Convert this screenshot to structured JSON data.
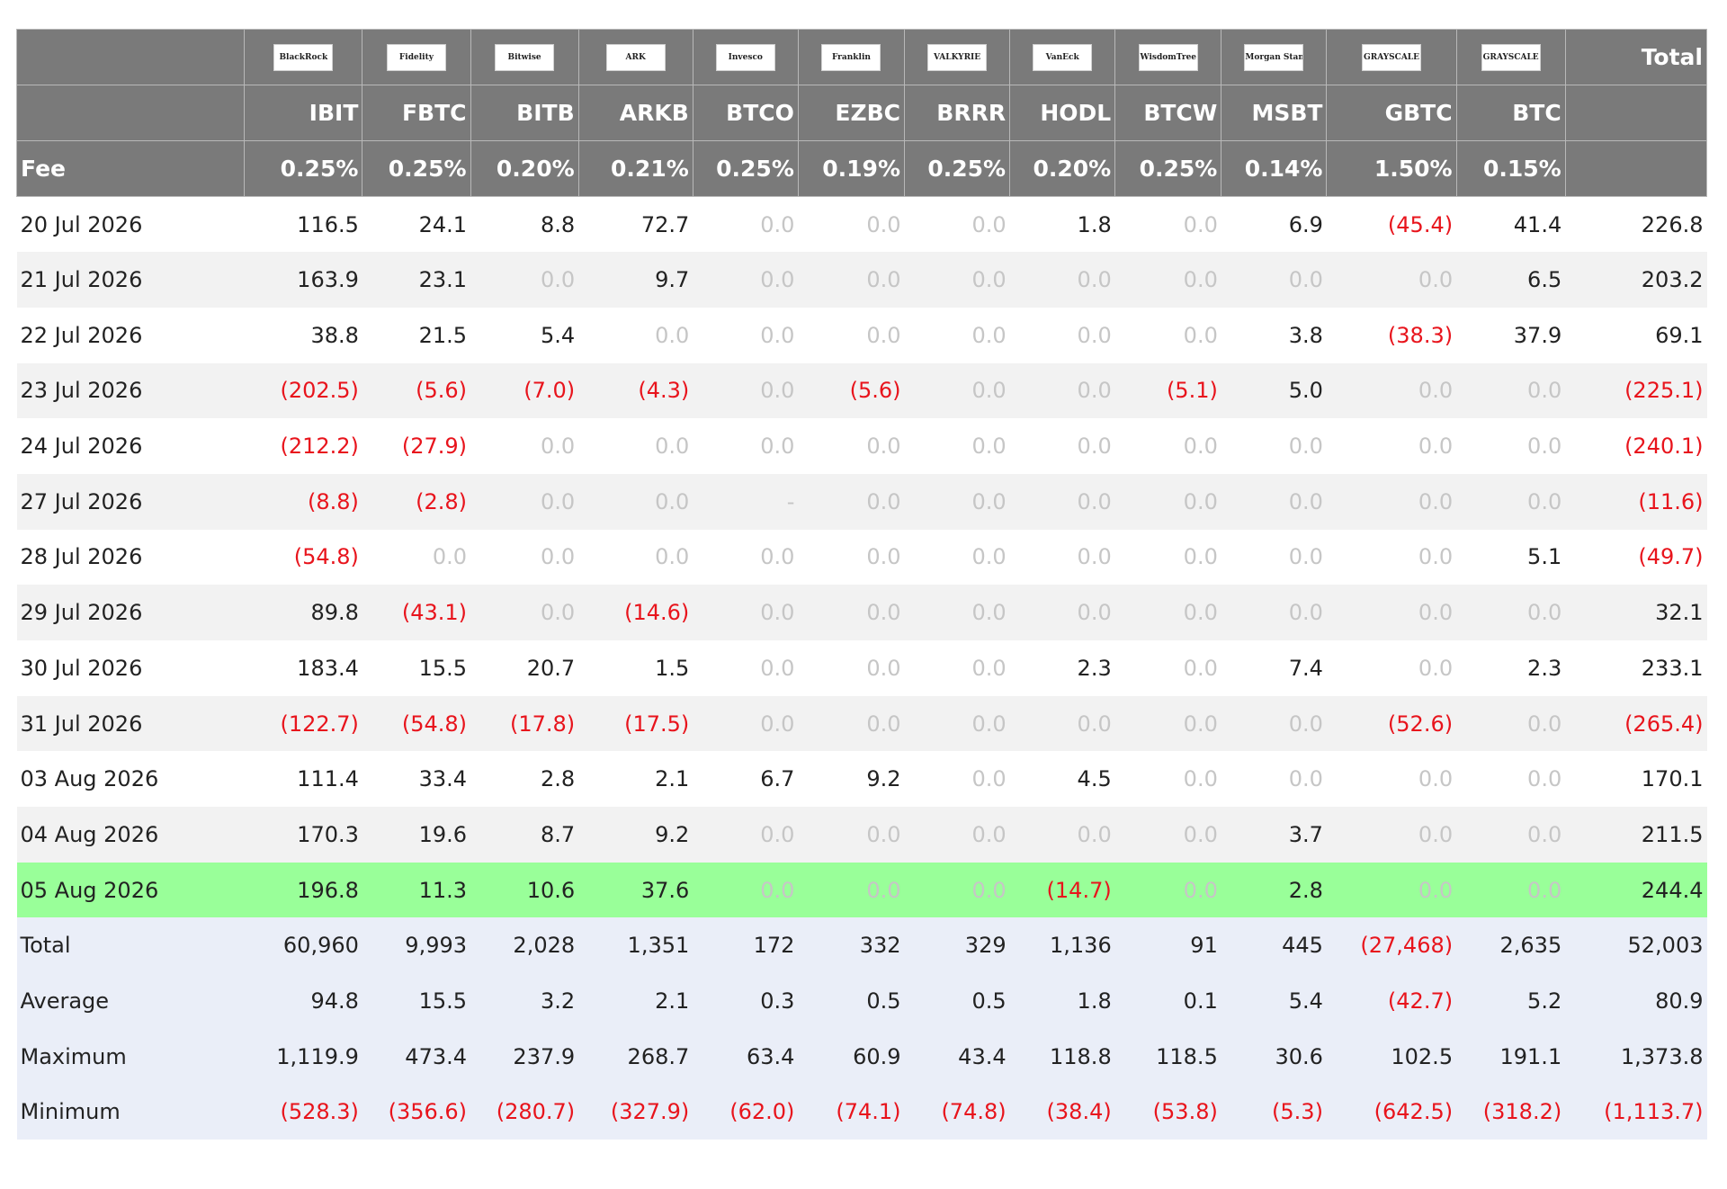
{
  "header": {
    "funds": [
      {
        "logo": "BlackRock",
        "ticker": "IBIT",
        "fee": "0.25%"
      },
      {
        "logo": "Fidelity",
        "ticker": "FBTC",
        "fee": "0.25%"
      },
      {
        "logo": "Bitwise",
        "ticker": "BITB",
        "fee": "0.20%"
      },
      {
        "logo": "ARK",
        "ticker": "ARKB",
        "fee": "0.21%"
      },
      {
        "logo": "Invesco",
        "ticker": "BTCO",
        "fee": "0.25%"
      },
      {
        "logo": "Franklin",
        "ticker": "EZBC",
        "fee": "0.19%"
      },
      {
        "logo": "VALKYRIE",
        "ticker": "BRRR",
        "fee": "0.25%"
      },
      {
        "logo": "VanEck",
        "ticker": "HODL",
        "fee": "0.20%"
      },
      {
        "logo": "WisdomTree",
        "ticker": "BTCW",
        "fee": "0.25%"
      },
      {
        "logo": "Morgan Stanley",
        "ticker": "MSBT",
        "fee": "0.14%"
      },
      {
        "logo": "GRAYSCALE",
        "ticker": "GBTC",
        "fee": "1.50%"
      },
      {
        "logo": "GRAYSCALE",
        "ticker": "BTC",
        "fee": "0.15%"
      }
    ],
    "total_label": "Total",
    "fee_label": "Fee"
  },
  "colors": {
    "negative": "#e8141c",
    "zero": "#c6c6c6",
    "highlight": "#99ff99",
    "header_bg": "#7a7a7a"
  },
  "rows": [
    {
      "date": "20 Jul 2026",
      "values": [
        "116.5",
        "24.1",
        "8.8",
        "72.7",
        "0.0",
        "0.0",
        "0.0",
        "1.8",
        "0.0",
        "6.9",
        "(45.4)",
        "41.4"
      ],
      "total": "226.8"
    },
    {
      "date": "21 Jul 2026",
      "values": [
        "163.9",
        "23.1",
        "0.0",
        "9.7",
        "0.0",
        "0.0",
        "0.0",
        "0.0",
        "0.0",
        "0.0",
        "0.0",
        "6.5"
      ],
      "total": "203.2"
    },
    {
      "date": "22 Jul 2026",
      "values": [
        "38.8",
        "21.5",
        "5.4",
        "0.0",
        "0.0",
        "0.0",
        "0.0",
        "0.0",
        "0.0",
        "3.8",
        "(38.3)",
        "37.9"
      ],
      "total": "69.1"
    },
    {
      "date": "23 Jul 2026",
      "values": [
        "(202.5)",
        "(5.6)",
        "(7.0)",
        "(4.3)",
        "0.0",
        "(5.6)",
        "0.0",
        "0.0",
        "(5.1)",
        "5.0",
        "0.0",
        "0.0"
      ],
      "total": "(225.1)"
    },
    {
      "date": "24 Jul 2026",
      "values": [
        "(212.2)",
        "(27.9)",
        "0.0",
        "0.0",
        "0.0",
        "0.0",
        "0.0",
        "0.0",
        "0.0",
        "0.0",
        "0.0",
        "0.0"
      ],
      "total": "(240.1)"
    },
    {
      "date": "27 Jul 2026",
      "values": [
        "(8.8)",
        "(2.8)",
        "0.0",
        "0.0",
        "-",
        "0.0",
        "0.0",
        "0.0",
        "0.0",
        "0.0",
        "0.0",
        "0.0"
      ],
      "total": "(11.6)"
    },
    {
      "date": "28 Jul 2026",
      "values": [
        "(54.8)",
        "0.0",
        "0.0",
        "0.0",
        "0.0",
        "0.0",
        "0.0",
        "0.0",
        "0.0",
        "0.0",
        "0.0",
        "5.1"
      ],
      "total": "(49.7)"
    },
    {
      "date": "29 Jul 2026",
      "values": [
        "89.8",
        "(43.1)",
        "0.0",
        "(14.6)",
        "0.0",
        "0.0",
        "0.0",
        "0.0",
        "0.0",
        "0.0",
        "0.0",
        "0.0"
      ],
      "total": "32.1"
    },
    {
      "date": "30 Jul 2026",
      "values": [
        "183.4",
        "15.5",
        "20.7",
        "1.5",
        "0.0",
        "0.0",
        "0.0",
        "2.3",
        "0.0",
        "7.4",
        "0.0",
        "2.3"
      ],
      "total": "233.1"
    },
    {
      "date": "31 Jul 2026",
      "values": [
        "(122.7)",
        "(54.8)",
        "(17.8)",
        "(17.5)",
        "0.0",
        "0.0",
        "0.0",
        "0.0",
        "0.0",
        "0.0",
        "(52.6)",
        "0.0"
      ],
      "total": "(265.4)"
    },
    {
      "date": "03 Aug 2026",
      "values": [
        "111.4",
        "33.4",
        "2.8",
        "2.1",
        "6.7",
        "9.2",
        "0.0",
        "4.5",
        "0.0",
        "0.0",
        "0.0",
        "0.0"
      ],
      "total": "170.1"
    },
    {
      "date": "04 Aug 2026",
      "values": [
        "170.3",
        "19.6",
        "8.7",
        "9.2",
        "0.0",
        "0.0",
        "0.0",
        "0.0",
        "0.0",
        "3.7",
        "0.0",
        "0.0"
      ],
      "total": "211.5"
    },
    {
      "date": "05 Aug 2026",
      "values": [
        "196.8",
        "11.3",
        "10.6",
        "37.6",
        "0.0",
        "0.0",
        "0.0",
        "(14.7)",
        "0.0",
        "2.8",
        "0.0",
        "0.0"
      ],
      "total": "244.4",
      "highlight": true
    }
  ],
  "summary": [
    {
      "label": "Total",
      "values": [
        "60,960",
        "9,993",
        "2,028",
        "1,351",
        "172",
        "332",
        "329",
        "1,136",
        "91",
        "445",
        "(27,468)",
        "2,635"
      ],
      "total": "52,003"
    },
    {
      "label": "Average",
      "values": [
        "94.8",
        "15.5",
        "3.2",
        "2.1",
        "0.3",
        "0.5",
        "0.5",
        "1.8",
        "0.1",
        "5.4",
        "(42.7)",
        "5.2"
      ],
      "total": "80.9"
    },
    {
      "label": "Maximum",
      "values": [
        "1,119.9",
        "473.4",
        "237.9",
        "268.7",
        "63.4",
        "60.9",
        "43.4",
        "118.8",
        "118.5",
        "30.6",
        "102.5",
        "191.1"
      ],
      "total": "1,373.8"
    },
    {
      "label": "Minimum",
      "values": [
        "(528.3)",
        "(356.6)",
        "(280.7)",
        "(327.9)",
        "(62.0)",
        "(74.1)",
        "(74.8)",
        "(38.4)",
        "(53.8)",
        "(5.3)",
        "(642.5)",
        "(318.2)"
      ],
      "total": "(1,113.7)"
    }
  ]
}
